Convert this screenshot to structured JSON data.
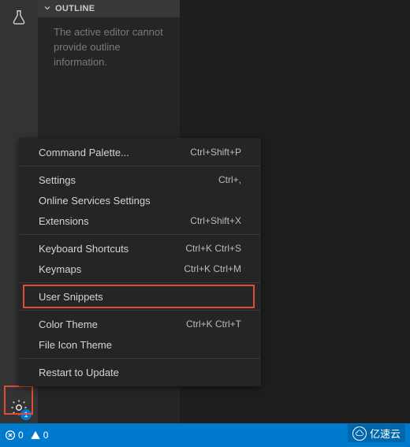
{
  "activityBar": {
    "gearBadge": "1"
  },
  "sidebar": {
    "outlineTitle": "OUTLINE",
    "outlineMessage": "The active editor cannot provide outline information."
  },
  "menu": {
    "items": [
      {
        "label": "Command Palette...",
        "shortcut": "Ctrl+Shift+P"
      }
    ],
    "group2": [
      {
        "label": "Settings",
        "shortcut": "Ctrl+,"
      },
      {
        "label": "Online Services Settings",
        "shortcut": ""
      },
      {
        "label": "Extensions",
        "shortcut": "Ctrl+Shift+X"
      }
    ],
    "group3": [
      {
        "label": "Keyboard Shortcuts",
        "shortcut": "Ctrl+K Ctrl+S"
      },
      {
        "label": "Keymaps",
        "shortcut": "Ctrl+K Ctrl+M"
      }
    ],
    "group4": [
      {
        "label": "User Snippets",
        "shortcut": ""
      }
    ],
    "group5": [
      {
        "label": "Color Theme",
        "shortcut": "Ctrl+K Ctrl+T"
      },
      {
        "label": "File Icon Theme",
        "shortcut": ""
      }
    ],
    "group6": [
      {
        "label": "Restart to Update",
        "shortcut": ""
      }
    ]
  },
  "statusBar": {
    "errors": "0",
    "warnings": "0"
  },
  "watermark": {
    "text": "亿速云"
  }
}
